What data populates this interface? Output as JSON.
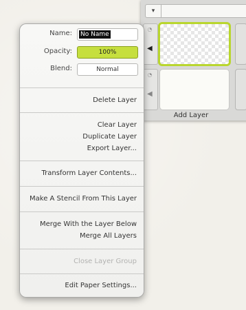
{
  "layers_panel": {
    "add_layer_label": "Add Layer",
    "dropdown_glyph": "▾",
    "eye_glyph": "👁",
    "arrow_glyph": "◀"
  },
  "menu": {
    "name_label": "Name:",
    "name_value": "No Name",
    "opacity_label": "Opacity:",
    "opacity_value": "100%",
    "blend_label": "Blend:",
    "blend_value": "Normal",
    "delete_layer": "Delete Layer",
    "clear_layer": "Clear Layer",
    "duplicate_layer": "Duplicate Layer",
    "export_layer": "Export Layer...",
    "transform_layer_contents": "Transform Layer Contents...",
    "make_stencil": "Make A Stencil From This Layer",
    "merge_with_below": "Merge With the Layer Below",
    "merge_all": "Merge All Layers",
    "close_layer_group": "Close Layer Group",
    "edit_paper_settings": "Edit Paper Settings..."
  },
  "colors": {
    "accent": "#c6df3e",
    "selected_border": "#b9d62e"
  }
}
